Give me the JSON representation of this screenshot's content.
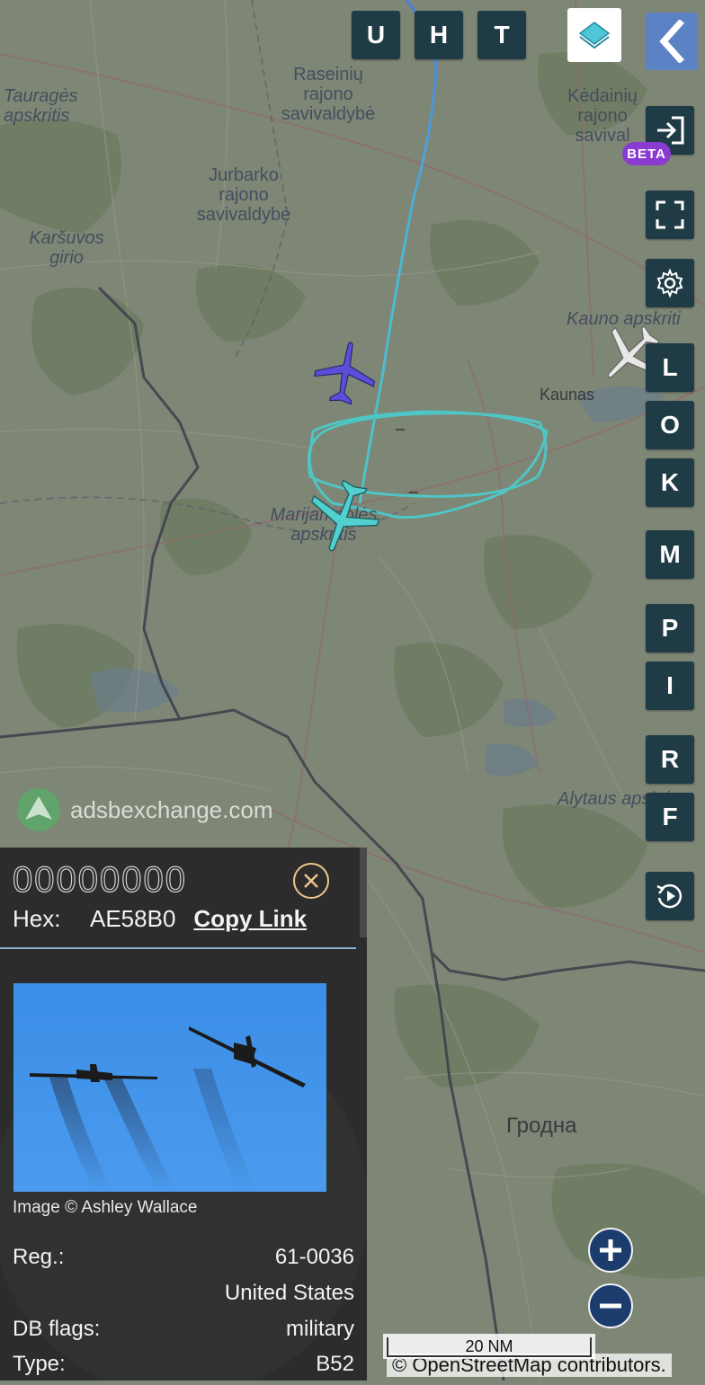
{
  "map": {
    "labels": {
      "taurages": "Tauragės\napskritis",
      "raseiniu": "Raseinių\nrajono\nsavivaldybė",
      "kedainiu": "Kėdainių\nrajono\nsavival",
      "jurbarko": "Jurbarko\nrajono\nsavivaldybė",
      "karsuvos": "Karšuvos\ngirio",
      "kauno_apskritis": "Kauno apskriti",
      "kaunas": "Kaunas",
      "marijampoles": "Marijampolės\napskritis",
      "alytaus": "Alytaus apskri",
      "grodna": "Гродна"
    },
    "watermark": "adsbexchange.com",
    "scale": "20 NM",
    "attribution": "© OpenStreetMap contributors."
  },
  "toolbar_top": {
    "u": "U",
    "h": "H",
    "t": "T"
  },
  "toolbar_right": {
    "beta": "BETA",
    "l": "L",
    "o": "O",
    "k": "K",
    "m": "M",
    "p": "P",
    "i": "I",
    "r": "R",
    "f": "F"
  },
  "panel": {
    "callsign": "00000000",
    "hex_label": "Hex:",
    "hex_value": "AE58B0",
    "copy_link": "Copy Link",
    "image_credit": "Image © Ashley Wallace",
    "reg_label": "Reg.:",
    "reg_value": "61-0036",
    "country": "United States",
    "db_flags_label": "DB flags:",
    "db_flags_value": "military",
    "type_label": "Type:",
    "type_value": "B52"
  },
  "colors": {
    "track_start": "#4a7de0",
    "track_end": "#4fc5c5",
    "selected_aircraft": "#52cfcf",
    "other_aircraft": "#5a4fd8",
    "gray_aircraft": "#e8e8e8",
    "toolbar_button": "#1f3b45",
    "beta_badge": "#8a3bd1"
  },
  "icons": {
    "layers": "layers-icon",
    "back": "chevron-left-icon",
    "login": "login-icon",
    "fullscreen": "fullscreen-icon",
    "settings": "gear-icon",
    "replay": "replay-icon",
    "close": "close-icon",
    "zoom_in": "plus-icon",
    "zoom_out": "minus-icon"
  }
}
